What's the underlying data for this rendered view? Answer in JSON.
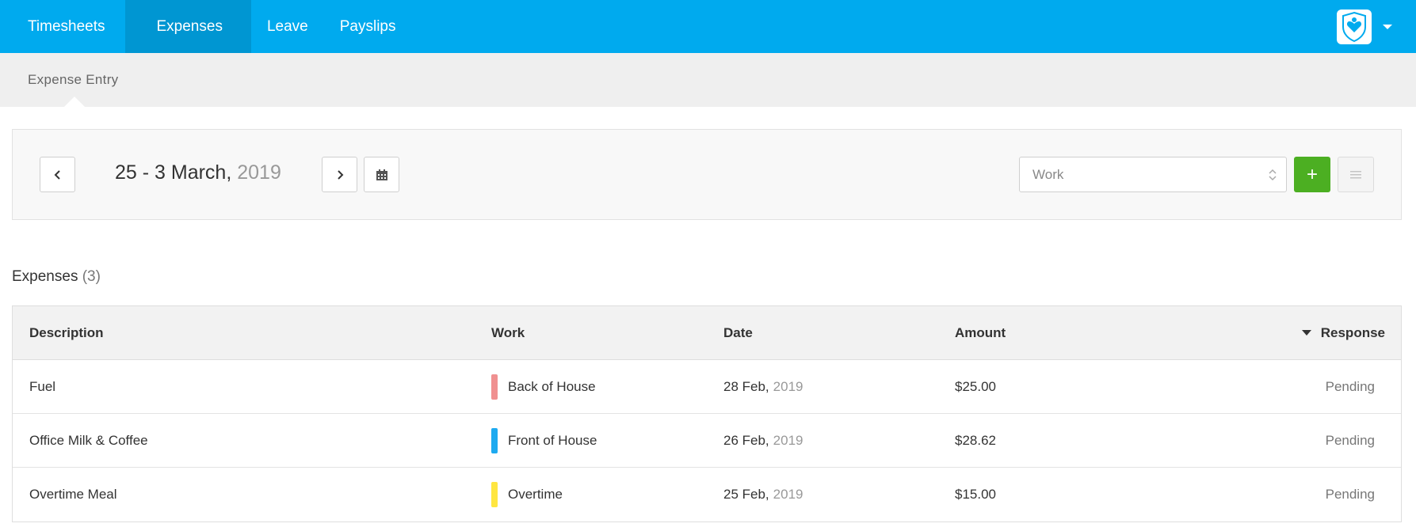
{
  "nav": {
    "items": [
      {
        "label": "Timesheets"
      },
      {
        "label": "Expenses",
        "active": true
      },
      {
        "label": "Leave"
      },
      {
        "label": "Payslips"
      }
    ]
  },
  "subbar": {
    "label": "Expense Entry"
  },
  "toolbar": {
    "date_range": "25 - 3 March,",
    "year": "2019",
    "work_select_value": "Work",
    "add_label": "+",
    "accent_color": "#4caf22"
  },
  "expenses": {
    "title": "Expenses",
    "count": "(3)",
    "columns": {
      "description": "Description",
      "work": "Work",
      "date": "Date",
      "amount": "Amount",
      "response": "Response"
    },
    "rows": [
      {
        "description": "Fuel",
        "work": "Back of House",
        "work_color": "#f09090",
        "date": "28 Feb,",
        "year": "2019",
        "amount": "$25.00",
        "response": "Pending"
      },
      {
        "description": "Office Milk & Coffee",
        "work": "Front of House",
        "work_color": "#1eaaf0",
        "date": "26 Feb,",
        "year": "2019",
        "amount": "$28.62",
        "response": "Pending"
      },
      {
        "description": "Overtime Meal",
        "work": "Overtime",
        "work_color": "#ffe640",
        "date": "25 Feb,",
        "year": "2019",
        "amount": "$15.00",
        "response": "Pending"
      }
    ]
  },
  "icons": {
    "prev": "chevron-left-icon",
    "next": "chevron-right-icon",
    "calendar": "calendar-icon",
    "menu": "list-menu-icon",
    "brand": "brand-shield-icon",
    "account_caret": "caret-down-icon"
  }
}
